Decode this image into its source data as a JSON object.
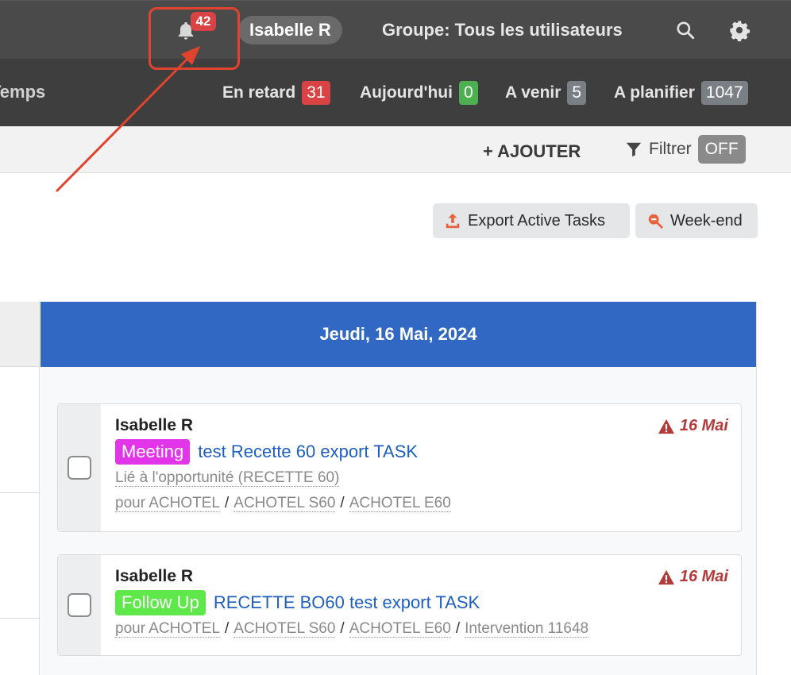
{
  "header": {
    "notifications_count": "42",
    "user_name": "Isabelle R",
    "group_label": "Groupe: Tous les utilisateurs",
    "icons": {
      "bell": "bell-icon",
      "search": "search-icon",
      "settings": "gear-icon"
    }
  },
  "subnav": {
    "tab_label": "Temps",
    "counters": [
      {
        "label": "En retard",
        "count": "31",
        "color": "#d94343"
      },
      {
        "label": "Aujourd'hui",
        "count": "0",
        "color": "#4caf50"
      },
      {
        "label": "A venir",
        "count": "5",
        "color": "#7a7f85"
      },
      {
        "label": "A planifier",
        "count": "1047",
        "color": "#7a7f85"
      }
    ]
  },
  "toolbar": {
    "add_label": "+ AJOUTER",
    "filter_label": "Filtrer",
    "filter_state": "OFF"
  },
  "actions": {
    "export_label": "Export Active Tasks",
    "weekend_label": "Week-end"
  },
  "calendar": {
    "day_header": "Jeudi, 16 Mai, 2024",
    "tasks": [
      {
        "assignee": "Isabelle R",
        "due": "16 Mai",
        "type": "Meeting",
        "type_color": "#e234e8",
        "title": "test Recette 60 export TASK",
        "linked": "Lié à l'opportunité (RECETTE 60)",
        "path": [
          "pour ACHOTEL",
          "ACHOTEL S60",
          "ACHOTEL E60"
        ]
      },
      {
        "assignee": "Isabelle R",
        "due": "16 Mai",
        "type": "Follow Up",
        "type_color": "#5ee84a",
        "title": "RECETTE BO60 test export TASK",
        "path": [
          "pour ACHOTEL",
          "ACHOTEL S60",
          "ACHOTEL E60",
          "Intervention 11648"
        ]
      }
    ]
  }
}
